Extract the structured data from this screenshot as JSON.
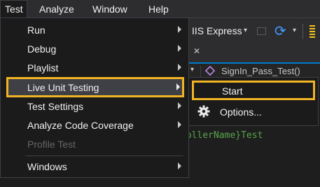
{
  "menubar": {
    "items": [
      {
        "label": "Test",
        "active": true
      },
      {
        "label": "Analyze"
      },
      {
        "label": "Window"
      },
      {
        "label": "Help"
      }
    ]
  },
  "toolbar": {
    "run_target": "IIS Express",
    "dropdown_arrow": "▾",
    "refresh_icon": "refresh-icon"
  },
  "tab": {
    "close_glyph": "✕"
  },
  "nav": {
    "member": "SignIn_Pass_Test()"
  },
  "editor": {
    "code_fragment": "rollerName}Test"
  },
  "test_menu": {
    "items": [
      {
        "label": "Run",
        "has_submenu": true
      },
      {
        "label": "Debug",
        "has_submenu": true
      },
      {
        "label": "Playlist",
        "has_submenu": true
      },
      {
        "label": "Live Unit Testing",
        "has_submenu": true,
        "highlighted": true
      },
      {
        "label": "Test Settings",
        "has_submenu": true
      },
      {
        "label": "Analyze Code Coverage",
        "has_submenu": true
      },
      {
        "label": "Profile Test",
        "disabled": true
      },
      {
        "label": "Windows",
        "has_submenu": true
      }
    ]
  },
  "live_unit_testing_submenu": {
    "items": [
      {
        "label": "Start",
        "highlighted": true
      },
      {
        "label": "Options...",
        "icon": "gear-icon"
      }
    ]
  },
  "colors": {
    "highlight_outline": "#f0b323",
    "menu_bg": "#1b1b1c",
    "menubar_bg": "#2d2d30",
    "accent": "#007acc"
  }
}
